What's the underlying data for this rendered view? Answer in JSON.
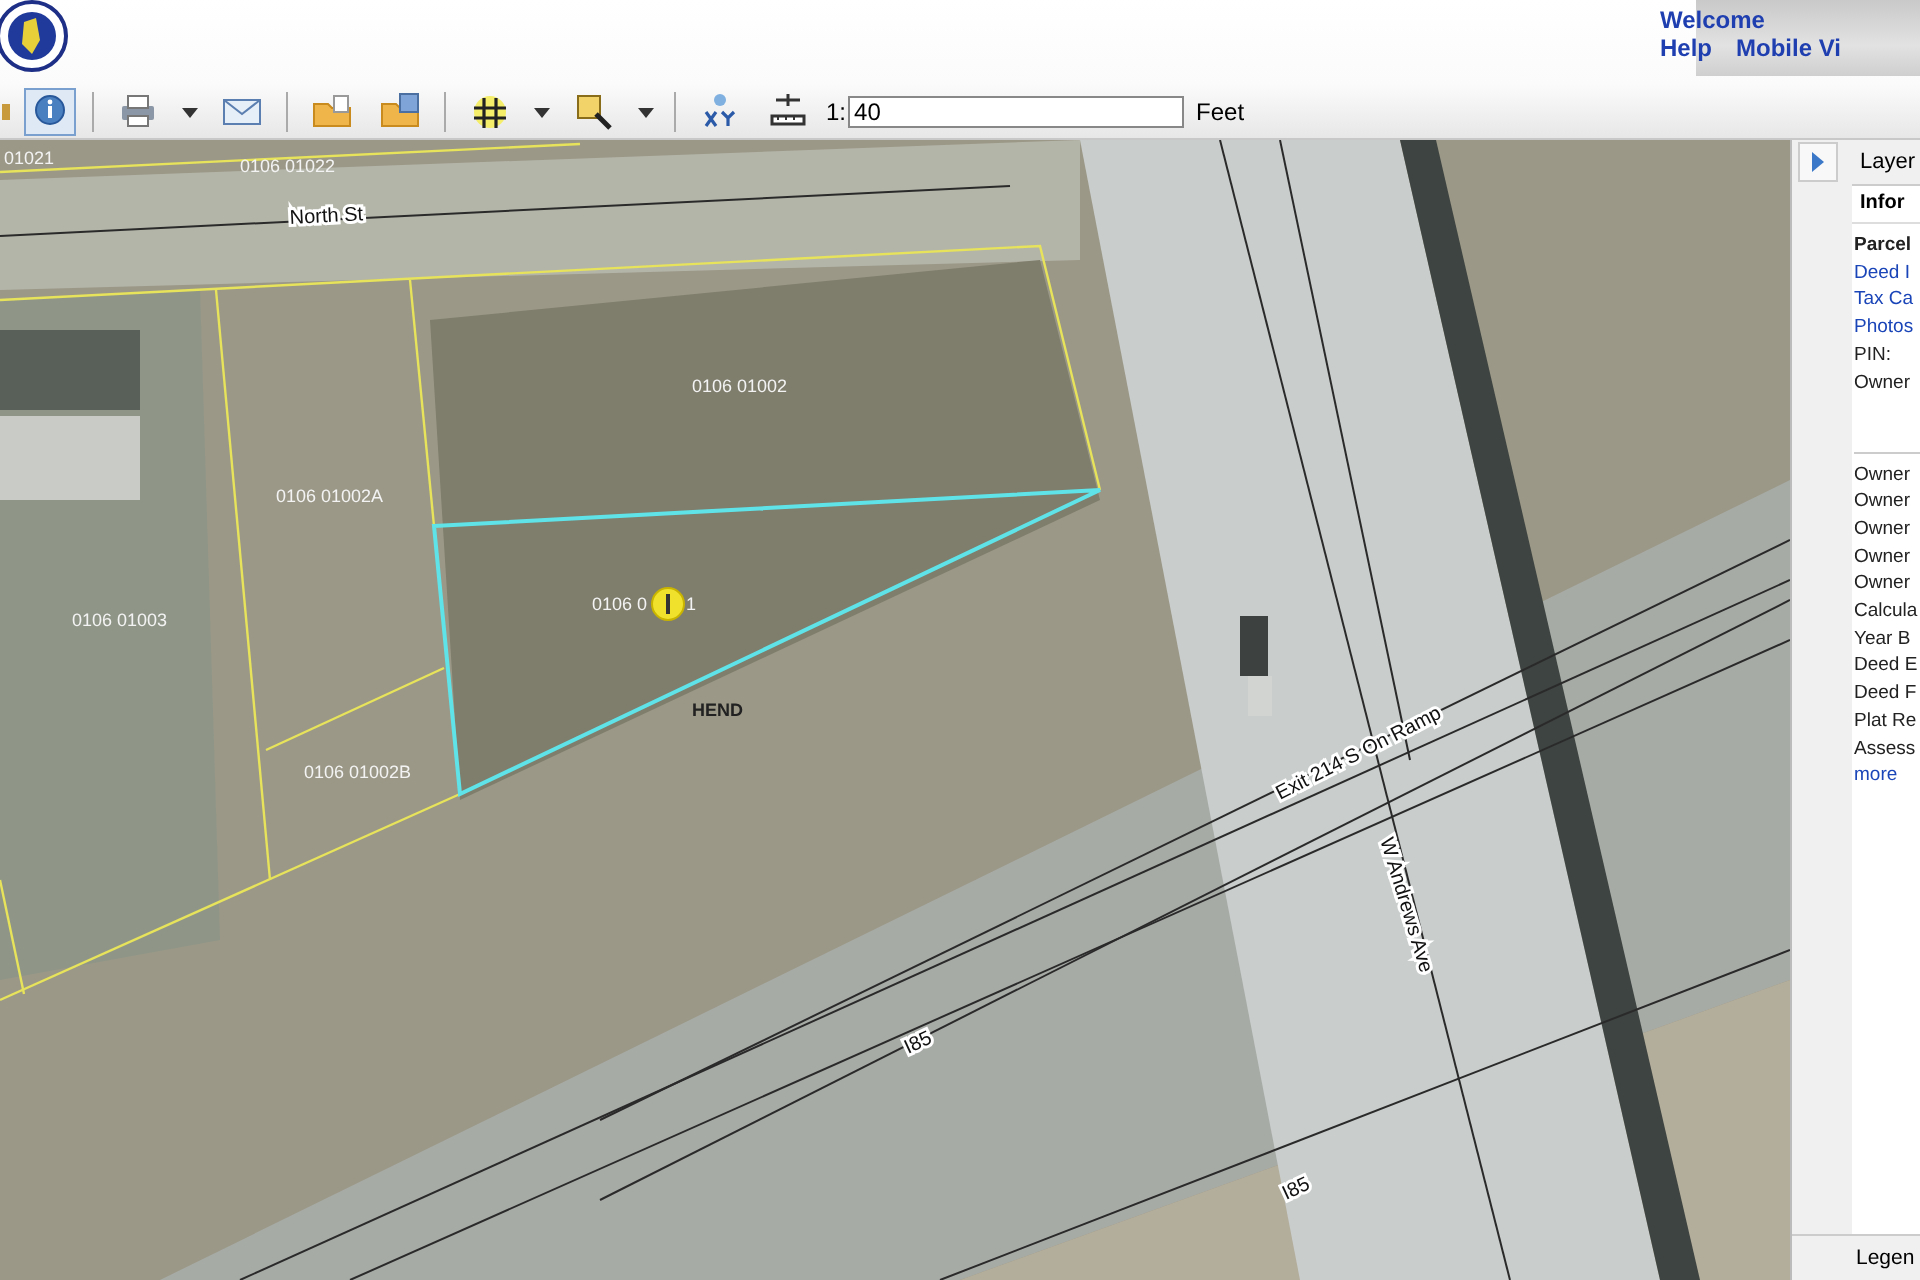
{
  "header": {
    "links": [
      {
        "label": "Welcome"
      },
      {
        "label": "Help"
      },
      {
        "label": "Mobile Vi"
      }
    ]
  },
  "toolbar": {
    "tools": [
      {
        "selected": false
      },
      {
        "selected": true
      },
      {
        "selected": false
      },
      {
        "selected": false
      },
      {
        "selected": false
      },
      {
        "selected": false
      },
      {
        "selected": false
      },
      {
        "selected": false
      },
      {
        "selected": false
      },
      {
        "selected": false
      }
    ],
    "scale": {
      "prefix": "1:",
      "value": "40",
      "unit": "Feet"
    }
  },
  "map": {
    "labels": [
      {
        "text": "01021",
        "kind": "parcel"
      },
      {
        "text": "0106 01022",
        "kind": "parcel"
      },
      {
        "text": "North St",
        "kind": "street"
      },
      {
        "text": "0106 01002",
        "kind": "parcel"
      },
      {
        "text": "0106 01002A",
        "kind": "parcel"
      },
      {
        "text": "0106 01003",
        "kind": "parcel"
      },
      {
        "text": "0106 0",
        "kind": "parcel"
      },
      {
        "text": "1",
        "kind": "parcel"
      },
      {
        "text": "HEND",
        "kind": "street"
      },
      {
        "text": "0106 01002B",
        "kind": "parcel"
      },
      {
        "text": "Exit 214 S On Ramp",
        "kind": "street"
      },
      {
        "text": "W Andrews Ave",
        "kind": "street"
      },
      {
        "text": "I85",
        "kind": "street"
      },
      {
        "text": "I85",
        "kind": "street"
      }
    ]
  },
  "side_panel": {
    "tab": "Layer",
    "section": "Infor",
    "items": [
      {
        "text": "Parcel",
        "kind": "heading"
      },
      {
        "text": "Deed I",
        "kind": "link"
      },
      {
        "text": "Tax Ca",
        "kind": "link"
      },
      {
        "text": "Photos",
        "kind": "link"
      },
      {
        "text": "PIN:",
        "kind": "field"
      },
      {
        "text": "Owner",
        "kind": "tall"
      },
      {
        "text": "Owner",
        "kind": "field"
      },
      {
        "text": "Owner",
        "kind": "field"
      },
      {
        "text": "Owner",
        "kind": "field"
      },
      {
        "text": "Owner",
        "kind": "field"
      },
      {
        "text": "Owner",
        "kind": "field"
      },
      {
        "text": "Calcula",
        "kind": "field"
      },
      {
        "text": "Year B",
        "kind": "field"
      },
      {
        "text": "Deed E",
        "kind": "field"
      },
      {
        "text": "Deed F",
        "kind": "field"
      },
      {
        "text": "Plat Re",
        "kind": "field"
      },
      {
        "text": "Assess",
        "kind": "field"
      },
      {
        "text": "more",
        "kind": "link"
      }
    ],
    "footer": "Legen"
  }
}
